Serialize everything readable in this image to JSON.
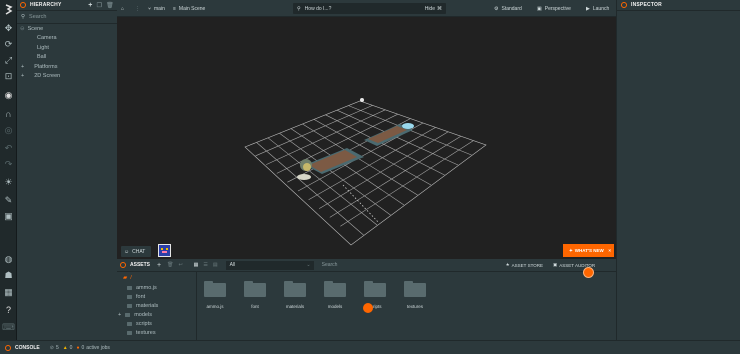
{
  "hierarchy": {
    "title": "HIERARCHY",
    "search_placeholder": "Search",
    "items": [
      "Scene",
      "Camera",
      "Light",
      "Ball",
      "Platforms",
      "2D Screen"
    ]
  },
  "viewport_toolbar": {
    "branch": "main",
    "scene": "Main Scene",
    "search_placeholder": "How do I...?",
    "hide": "Hide",
    "hide_key": "⌘",
    "standard": "Standard",
    "perspective": "Perspective",
    "launch": "Launch"
  },
  "viewport": {
    "chat": "CHAT",
    "whats_new": "WHAT'S NEW"
  },
  "inspector": {
    "title": "INSPECTOR"
  },
  "assets": {
    "title": "ASSETS",
    "filter": "All",
    "search_placeholder": "Search",
    "asset_store": "ASSET STORE",
    "asset_auditor": "ASSET AUDITOR",
    "root": "/",
    "tree": [
      "ammo.js",
      "font",
      "materials",
      "models",
      "scripts",
      "textures"
    ],
    "folders": [
      "ammo.js",
      "font",
      "materials",
      "models",
      "scripts",
      "textures"
    ]
  },
  "console": {
    "title": "CONSOLE",
    "errors": "5",
    "warnings": "0",
    "jobs_count": "0",
    "jobs_label": "active jobs"
  },
  "colors": {
    "accent": "#ff6600",
    "panel": "#2c393c",
    "background": "#20292b",
    "viewport": "#212121"
  }
}
